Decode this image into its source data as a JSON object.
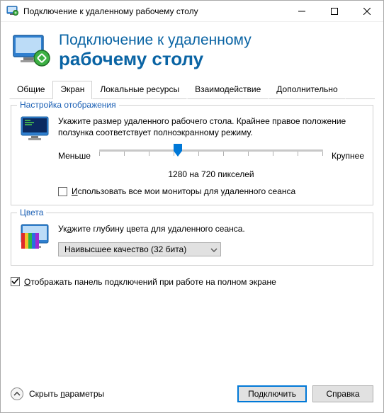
{
  "title": "Подключение к удаленному рабочему столу",
  "header": {
    "line1": "Подключение к удаленному",
    "line2": "рабочему столу"
  },
  "tabs": [
    {
      "label": "Общие"
    },
    {
      "label": "Экран"
    },
    {
      "label": "Локальные ресурсы"
    },
    {
      "label": "Взаимодействие"
    },
    {
      "label": "Дополнительно"
    }
  ],
  "display_group": {
    "title": "Настройка отображения",
    "desc": "Укажите размер удаленного рабочего стола. Крайнее правое положение ползунка соответствует полноэкранному режиму.",
    "less": "Меньше",
    "more": "Крупнее",
    "resolution": "1280 на 720 пикселей",
    "slider_percent": 35,
    "use_all_monitors": "Использовать все мои мониторы для удаленного сеанса",
    "use_all_monitors_checked": false
  },
  "colors_group": {
    "title": "Цвета",
    "desc": "Укажите глубину цвета для удаленного сеанса.",
    "selected": "Наивысшее качество (32 бита)"
  },
  "show_bar": {
    "label": "Отображать панель подключений при работе на полном экране",
    "checked": true
  },
  "footer": {
    "hide": "Скрыть параметры",
    "connect": "Подключить",
    "help": "Справка"
  }
}
